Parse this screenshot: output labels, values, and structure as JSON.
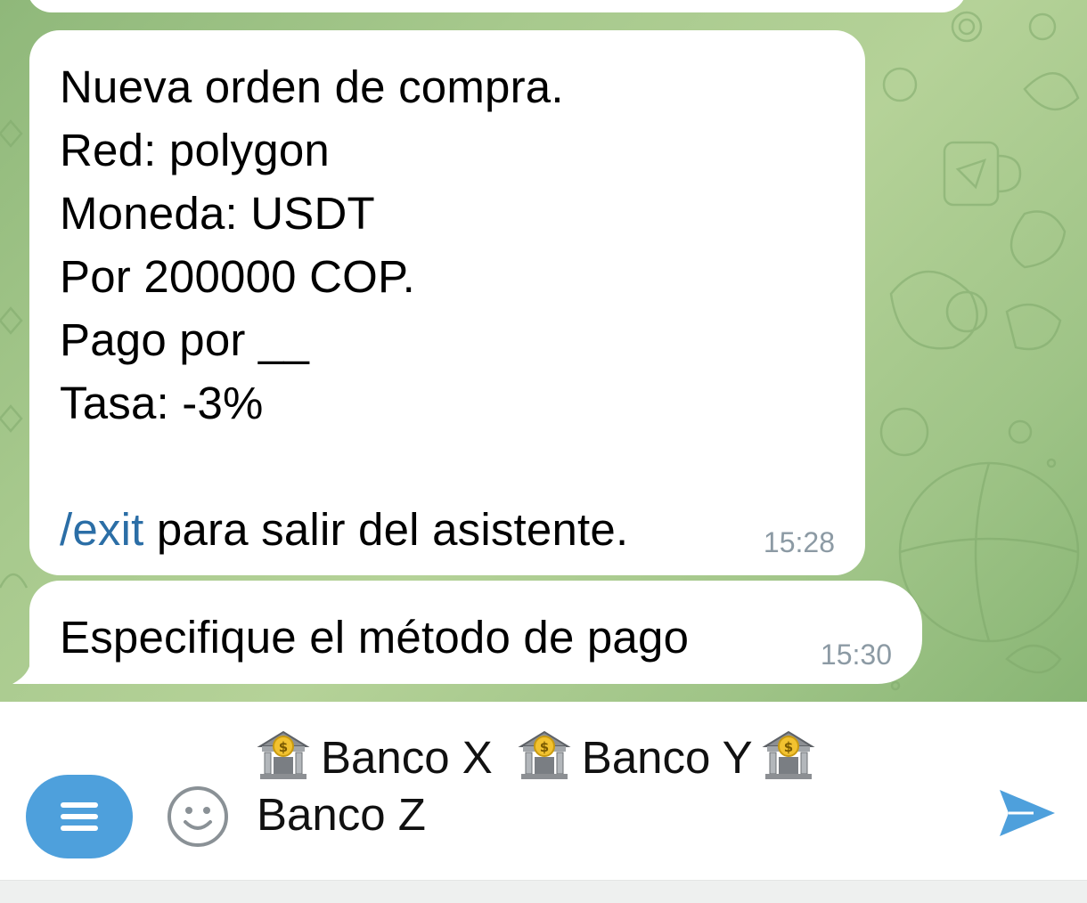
{
  "chat": {
    "messages": [
      {
        "lines": [
          "Nueva orden de compra.",
          "Red: polygon",
          "Moneda: USDT",
          "Por 200000 COP.",
          "Pago por __",
          "Tasa: -3%"
        ],
        "command": "/exit",
        "command_rest": " para salir del asistente.",
        "time": "15:28"
      },
      {
        "text": "Especifique el método de pago",
        "time": "15:30"
      }
    ]
  },
  "composer": {
    "banks": [
      "Banco X",
      "Banco Y",
      "Banco Z"
    ],
    "icons": {
      "menu": "menu-icon",
      "emoji": "emoji-icon",
      "bank": "bank-icon",
      "send": "send-icon"
    }
  },
  "colors": {
    "accent": "#4ea0dc",
    "link": "#2b6ea6",
    "timestamp": "#8c9aa4",
    "wallpaper": "#a7c98d"
  }
}
